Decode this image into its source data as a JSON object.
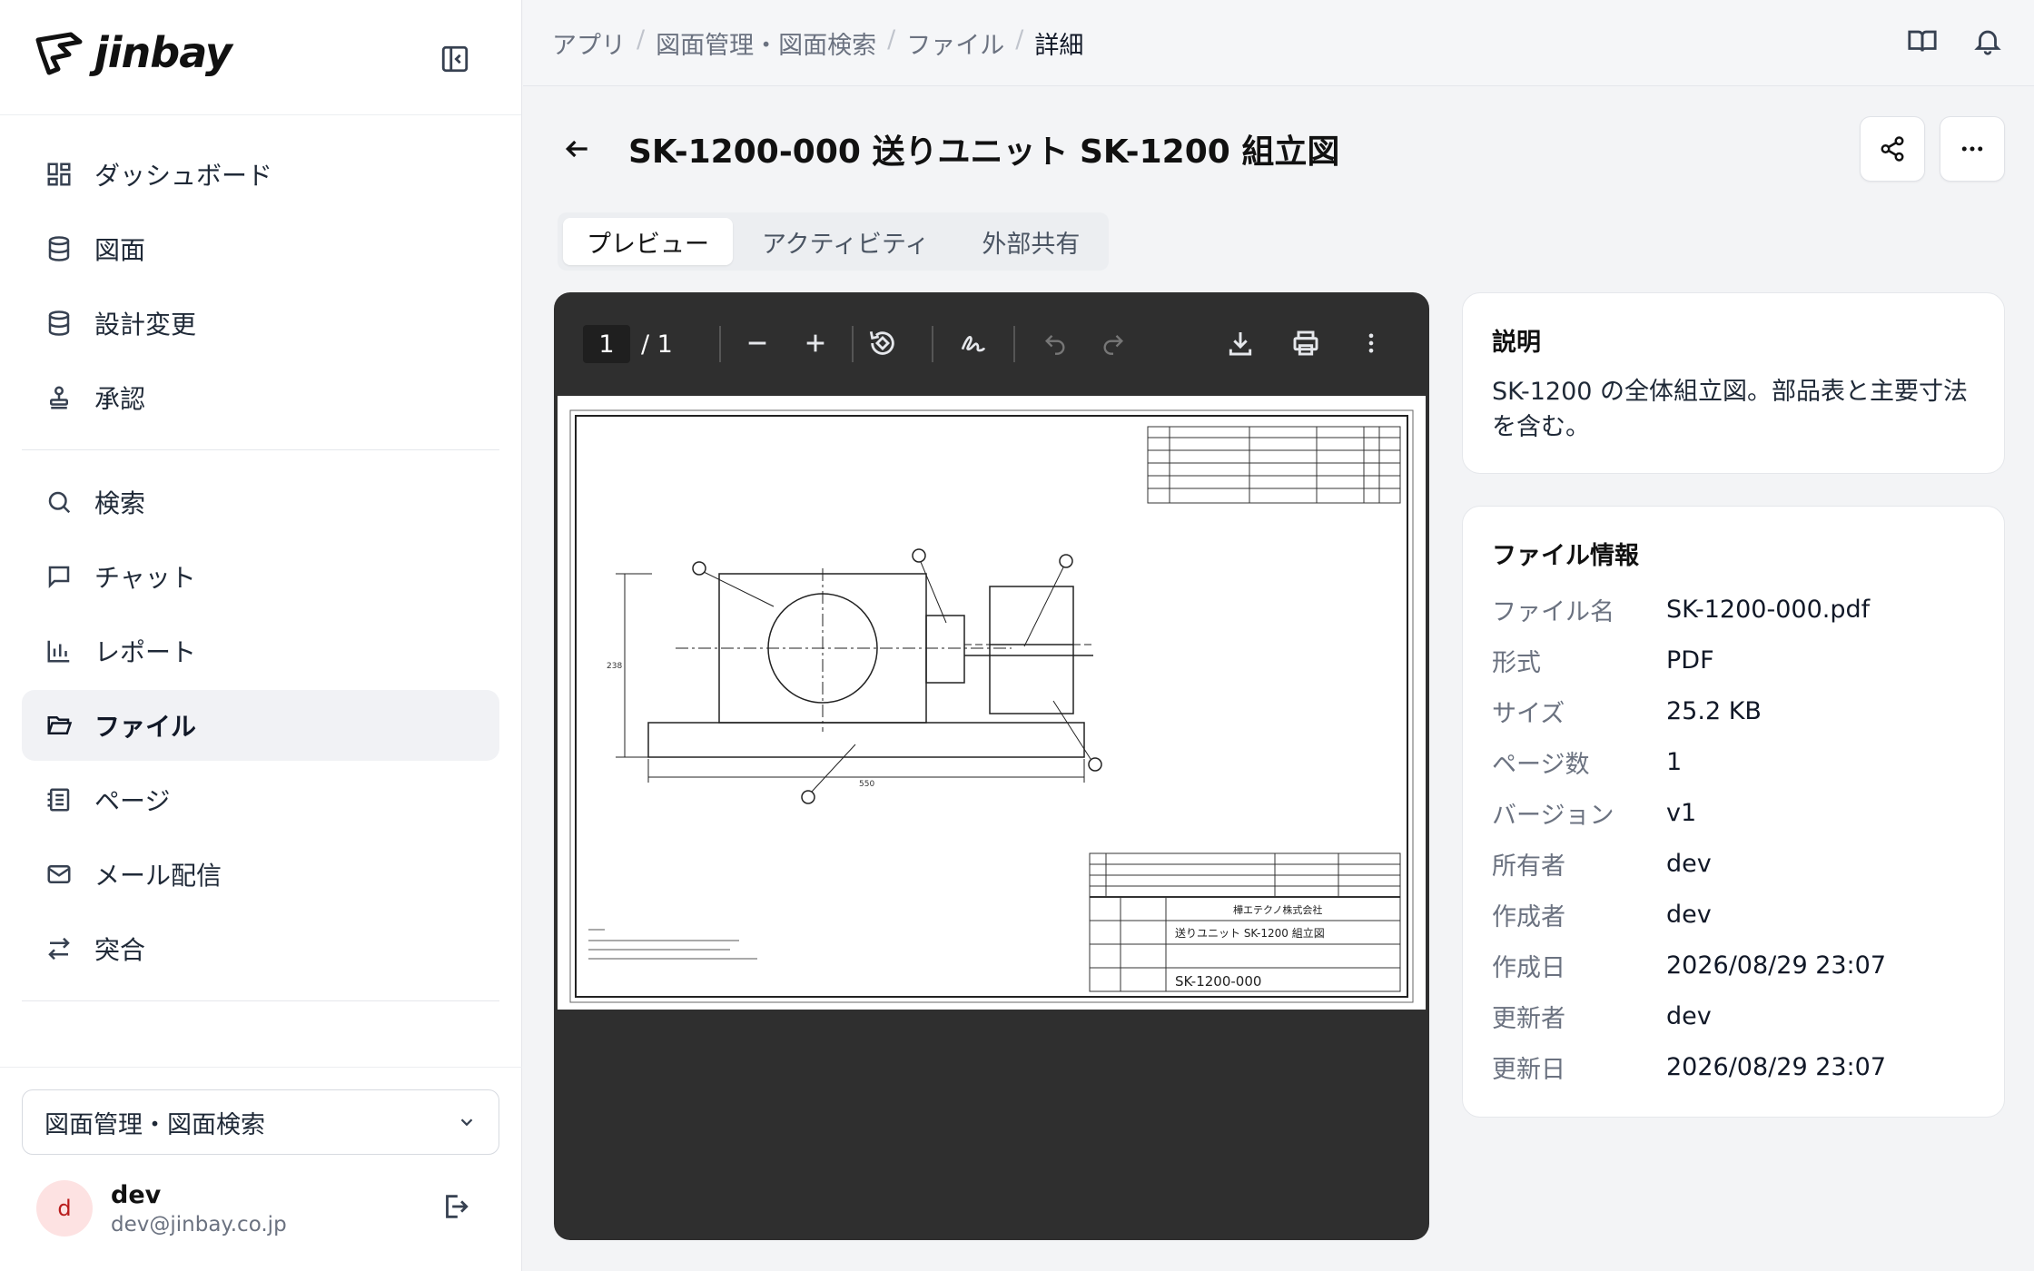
{
  "brand": {
    "name": "jinbay"
  },
  "sidebar": {
    "items": [
      {
        "label": "ダッシュボード",
        "icon": "dashboard-icon"
      },
      {
        "label": "図面",
        "icon": "database-icon"
      },
      {
        "label": "設計変更",
        "icon": "database-icon"
      },
      {
        "label": "承認",
        "icon": "stamp-icon"
      },
      {
        "label": "検索",
        "icon": "search-icon"
      },
      {
        "label": "チャット",
        "icon": "chat-icon"
      },
      {
        "label": "レポート",
        "icon": "bar-chart-icon"
      },
      {
        "label": "ファイル",
        "icon": "folder-open-icon",
        "active": true
      },
      {
        "label": "ページ",
        "icon": "notebook-icon"
      },
      {
        "label": "メール配信",
        "icon": "mail-icon"
      },
      {
        "label": "突合",
        "icon": "arrows-exchange-icon"
      }
    ],
    "workspace": "図面管理・図面検索",
    "user": {
      "initial": "d",
      "name": "dev",
      "email": "dev@jinbay.co.jp"
    }
  },
  "breadcrumb": {
    "items": [
      "アプリ",
      "図面管理・図面検索",
      "ファイル"
    ],
    "current": "詳細"
  },
  "page": {
    "title": "SK-1200-000 送りユニット SK-1200 組立図"
  },
  "tabs": [
    {
      "label": "プレビュー",
      "active": true
    },
    {
      "label": "アクティビティ"
    },
    {
      "label": "外部共有"
    }
  ],
  "viewer": {
    "page_current": "1",
    "page_total": "/ 1"
  },
  "drawing": {
    "title_block_name": "送りユニット SK-1200 組立図",
    "drawing_number": "SK-1200-000",
    "company": "樺エテクノ株式会社",
    "dimension_height": "238",
    "dimension_width": "550"
  },
  "description": {
    "title": "説明",
    "text": "SK-1200 の全体組立図。部品表と主要寸法を含む。"
  },
  "file_info": {
    "title": "ファイル情報",
    "rows": [
      {
        "k": "ファイル名",
        "v": "SK-1200-000.pdf"
      },
      {
        "k": "形式",
        "v": "PDF"
      },
      {
        "k": "サイズ",
        "v": "25.2 KB"
      },
      {
        "k": "ページ数",
        "v": "1"
      },
      {
        "k": "バージョン",
        "v": "v1"
      },
      {
        "k": "所有者",
        "v": "dev"
      },
      {
        "k": "作成者",
        "v": "dev"
      },
      {
        "k": "作成日",
        "v": "2026/08/29 23:07"
      },
      {
        "k": "更新者",
        "v": "dev"
      },
      {
        "k": "更新日",
        "v": "2026/08/29 23:07"
      }
    ]
  }
}
